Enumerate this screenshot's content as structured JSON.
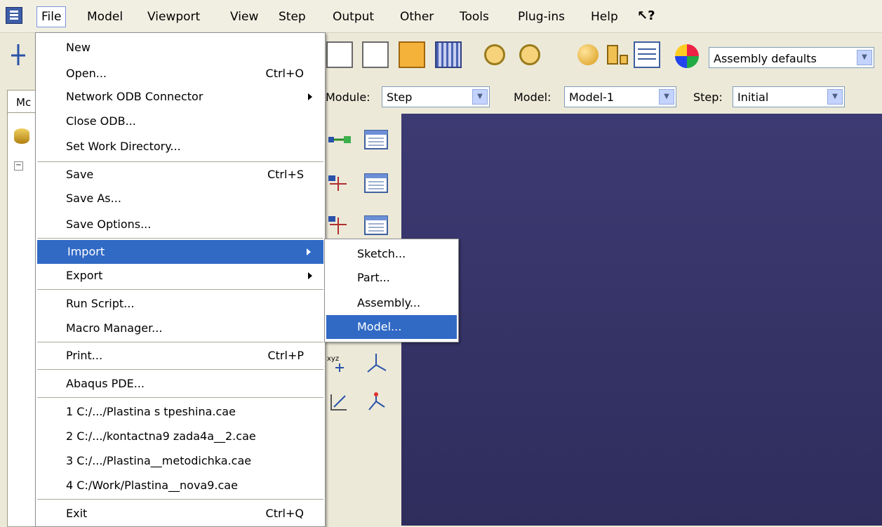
{
  "menubar": {
    "items": [
      "File",
      "Model",
      "Viewport",
      "View",
      "Step",
      "Output",
      "Other",
      "Tools",
      "Plug-ins",
      "Help"
    ],
    "whats_this": "↖?"
  },
  "toolbar": {
    "render_style_select": "Assembly defaults"
  },
  "context": {
    "module_label": "Module:",
    "module_value": "Step",
    "model_label": "Model:",
    "model_value": "Model-1",
    "step_label": "Step:",
    "step_value": "Initial"
  },
  "model_tree": {
    "tab_label": "Mc"
  },
  "file_menu": {
    "new": "New",
    "open": "Open...",
    "open_shortcut": "Ctrl+O",
    "network_odb": "Network ODB Connector",
    "close_odb": "Close ODB...",
    "set_work_dir": "Set Work Directory...",
    "save": "Save",
    "save_shortcut": "Ctrl+S",
    "save_as": "Save As...",
    "save_options": "Save Options...",
    "import": "Import",
    "export": "Export",
    "run_script": "Run Script...",
    "macro_manager": "Macro Manager...",
    "print": "Print...",
    "print_shortcut": "Ctrl+P",
    "abaqus_pde": "Abaqus PDE...",
    "recent_1": "1 C:/.../Plastina s tpeshina.cae",
    "recent_2": "2 C:/.../kontactna9 zada4a__2.cae",
    "recent_3": "3 C:/.../Plastina__metodichka.cae",
    "recent_4": "4 C:/Work/Plastina__nova9.cae",
    "exit": "Exit",
    "exit_shortcut": "Ctrl+Q"
  },
  "import_submenu": {
    "sketch": "Sketch...",
    "part": "Part...",
    "assembly": "Assembly...",
    "model": "Model..."
  },
  "colors": {
    "menu_highlight": "#316ac5",
    "viewport_bg": "#3c3a72",
    "chrome": "#ece9d8"
  }
}
